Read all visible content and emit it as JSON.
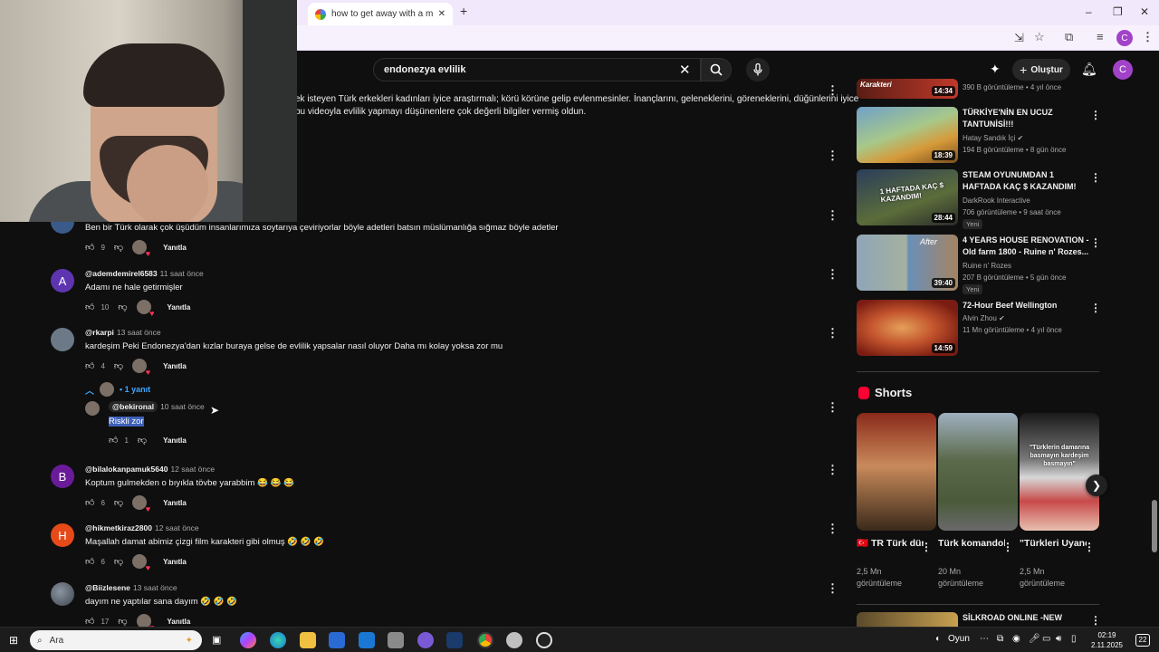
{
  "browser": {
    "tab_title": "how to get away with a murde",
    "new_tab": "+",
    "minimize": "–",
    "restore": "❐",
    "close": "✕",
    "profile_initial": "C"
  },
  "youtube": {
    "search_value": "endonezya evlilik",
    "create_label": "Oluştur",
    "profile_initial": "C"
  },
  "description": {
    "line1": "ek isteyen Türk erkekleri  kadınları iyice araştırmalı; körü körüne gelip evlenmesinler. İnançlarını, geleneklerini, göreneklerini, düğünlerini iyice",
    "line2": "bu videoyla evlilik yapmayı düşünenlere çok değerli bilgiler vermiş oldun."
  },
  "comments": [
    {
      "handle": "",
      "time": "",
      "text": "Ben bir Türk olarak çok üşüdüm insanlarımıza soytarıya çeviriyorlar böyle adetleri batsın müslümanlığa sığmaz böyle adetler",
      "likes": "9",
      "reply": "Yanıtla",
      "initial": ""
    },
    {
      "handle": "@ademdemirel6583",
      "time": "11 saat önce",
      "text": "Adamı ne hale getirmişler",
      "likes": "10",
      "reply": "Yanıtla",
      "initial": "A"
    },
    {
      "handle": "@rkarpi",
      "time": "13 saat önce",
      "text": "kardeşim Peki Endonezya'dan kızlar buraya gelse de evlilik yapsalar nasıl oluyor Daha mı kolay yoksa zor mu",
      "likes": "4",
      "reply": "Yanıtla",
      "initial": ""
    },
    {
      "handle": "@bilalokanpamuk5640",
      "time": "12 saat önce",
      "text": "Koptum gulmekden o bıyıkla tövbe yarabbim 😂 😂 😂",
      "likes": "6",
      "reply": "Yanıtla",
      "initial": "B"
    },
    {
      "handle": "@hikmetkiraz2800",
      "time": "12 saat önce",
      "text": "Maşallah damat abimiz çizgi film karakteri gibi olmuş 🤣 🤣 🤣",
      "likes": "6",
      "reply": "Yanıtla",
      "initial": "H"
    },
    {
      "handle": "@Biizlesene",
      "time": "13 saat önce",
      "text": "dayım ne yaptılar sana dayım 🤣 🤣 🤣",
      "likes": "17",
      "reply": "Yanıtla",
      "initial": ""
    }
  ],
  "reply_thread": {
    "toggle_label": "• 1 yanıt",
    "handle": "@bekironal",
    "time": "10 saat önce",
    "text": "Riskli zor",
    "likes": "1",
    "reply": "Yanıtla"
  },
  "sidebar_videos": [
    {
      "title": "",
      "channel": "",
      "meta": "390 B görüntüleme • 4 yıl önce",
      "duration": "14:34",
      "thumb_text": "Karakteri",
      "new": ""
    },
    {
      "title": "TÜRKİYE'NİN EN UCUZ TANTUNİSİ!!!",
      "channel": "Hatay Sandık İçi",
      "meta": "194 B görüntüleme • 8 gün önce",
      "duration": "18:39",
      "thumb_text": "",
      "new": ""
    },
    {
      "title": "STEAM OYUNUMDAN 1 HAFTADA KAÇ $ KAZANDIM!",
      "channel": "DarkRook Interactive",
      "meta": "706 görüntüleme • 9 saat önce",
      "duration": "28:44",
      "thumb_text": "1 HAFTADA KAÇ $ KAZANDIM!",
      "new": "Yeni"
    },
    {
      "title": "4 YEARS HOUSE RENOVATION - Old farm 1800 - Ruine n' Rozes...",
      "channel": "Ruine n' Rozes",
      "meta": "207 B görüntüleme • 5 gün önce",
      "duration": "39:40",
      "thumb_text": "After",
      "new": "Yeni"
    },
    {
      "title": "72-Hour Beef Wellington",
      "channel": "Alvin Zhou",
      "meta": "11 Mn görüntüleme • 4 yıl önce",
      "duration": "14:59",
      "thumb_text": "",
      "new": ""
    }
  ],
  "shorts": {
    "heading": "Shorts",
    "items": [
      {
        "title": "🇹🇷 TR Türk dünyasını ...",
        "views": "2,5 Mn",
        "views_label": "görüntüleme",
        "overlay": ""
      },
      {
        "title": "Türk komandola...",
        "views": "20 Mn",
        "views_label": "görüntüleme",
        "overlay": ""
      },
      {
        "title": "\"Türkleri Uyandırma...",
        "views": "2,5 Mn",
        "views_label": "görüntüleme",
        "overlay": "\"Türklerin damarına basmayın kardeşim basmayın\""
      }
    ]
  },
  "bottom_video": {
    "title": "SİLKROAD ONLINE -NEW"
  },
  "taskbar": {
    "search_placeholder": "Ara",
    "tray_label": "Oyun",
    "time": "02:19",
    "date": "2.11.2025",
    "notifications": "22"
  }
}
